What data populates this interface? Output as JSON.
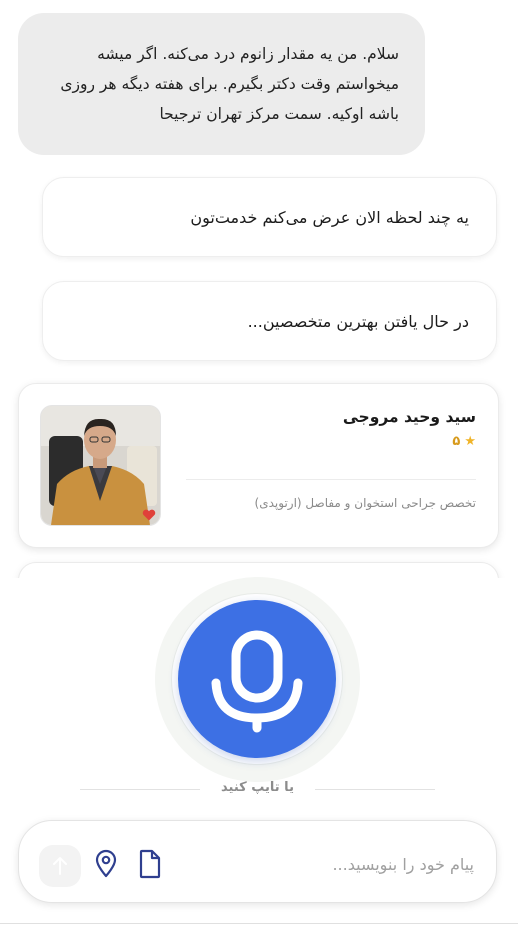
{
  "chat": {
    "user_message": "سلام. من یه مقدار زانوم درد می‌کنه. اگر میشه میخواستم وقت دکتر بگیرم. برای هفته دیگه هر روزی باشه اوکیه. سمت مرکز تهران ترجیحا",
    "bot_messages": [
      "یه چند لحظه الان عرض می‌کنم خدمت‌تون",
      "در حال یافتن بهترین متخصصین..."
    ]
  },
  "doctor_card": {
    "name": "سید وحید مروجی",
    "rating": "۵",
    "specialty": "تخصص جراحی استخوان و مفاصل (ارتوپدی)",
    "photo_icon": "doctor-portrait",
    "badge_icon": "heart-icon"
  },
  "voice": {
    "mic_icon": "microphone-icon",
    "or_type_label": "یا تایپ کنید",
    "accent_color": "#3d70e4"
  },
  "input": {
    "placeholder": "پیام خود را بنویسید...",
    "value": "",
    "file_icon": "file-icon",
    "location_icon": "location-pin-icon",
    "send_icon": "arrow-up-icon"
  }
}
